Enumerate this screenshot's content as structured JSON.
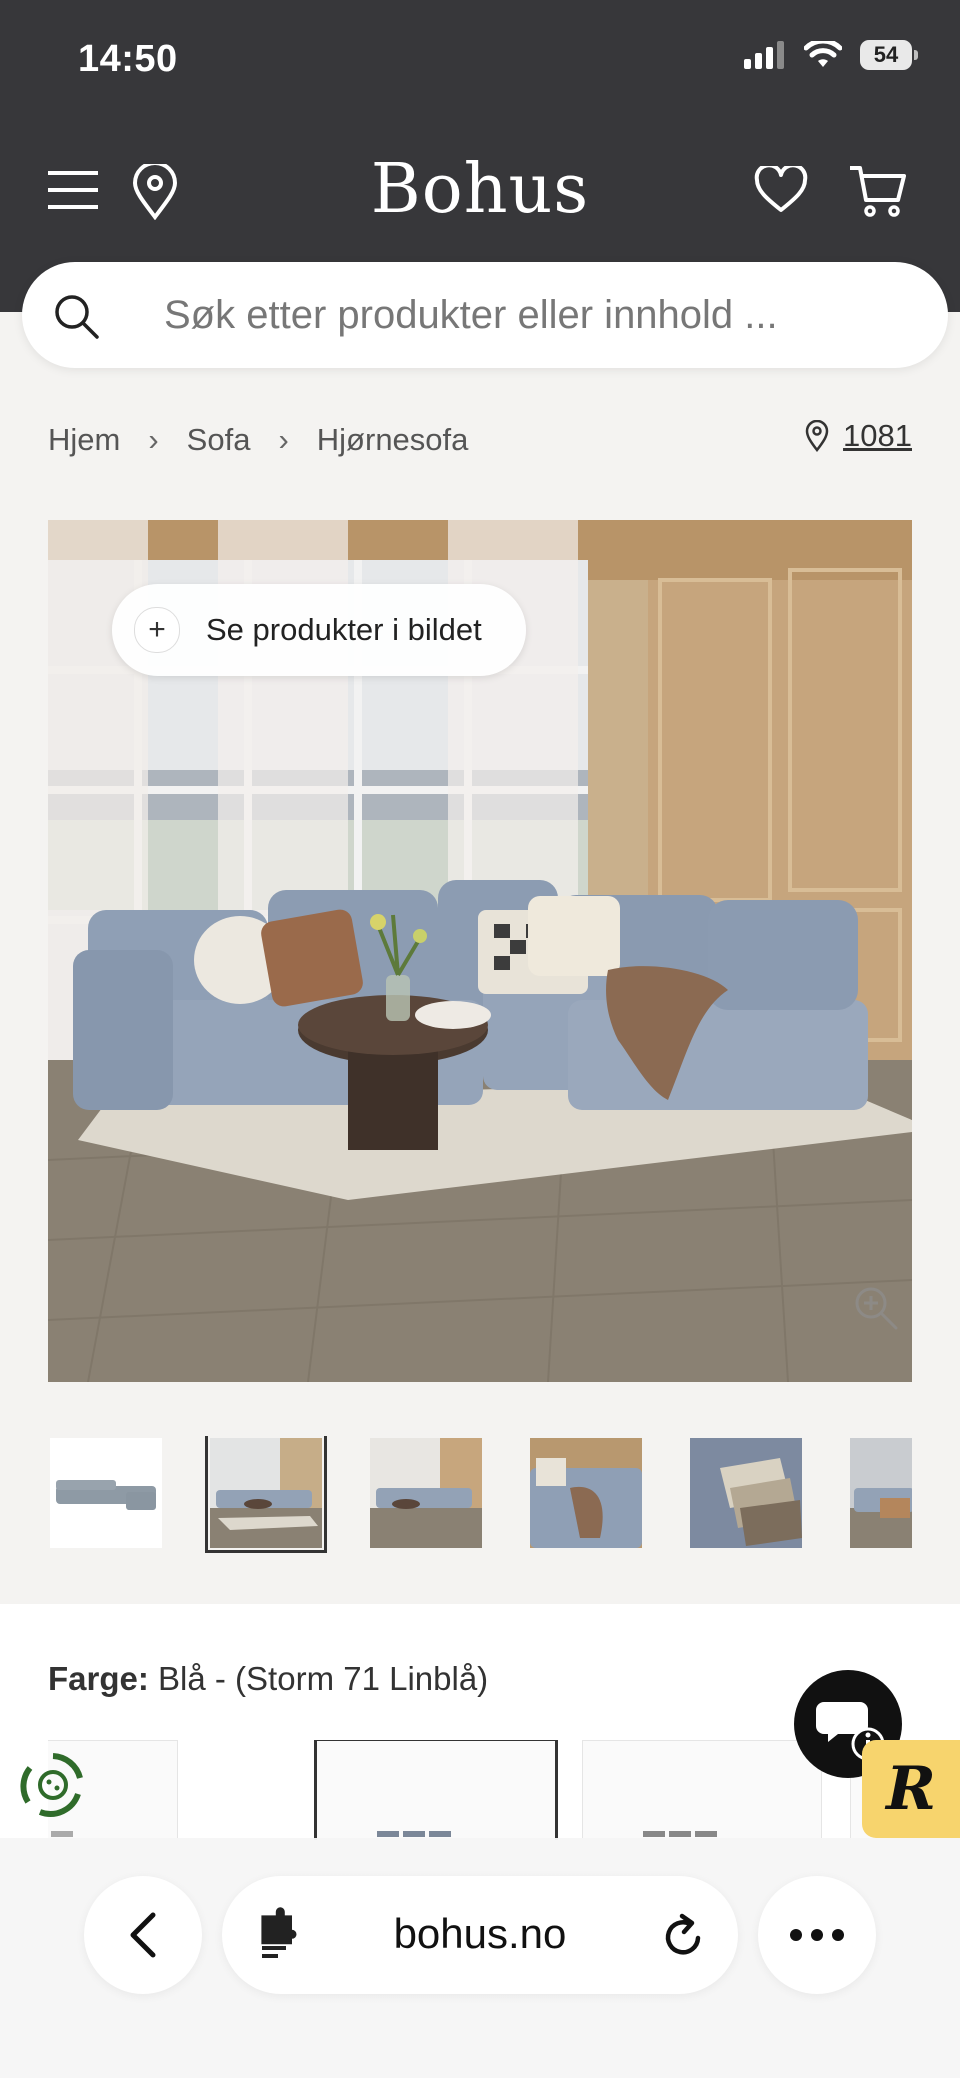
{
  "status_bar": {
    "time": "14:50",
    "battery": "54"
  },
  "header": {
    "brand": "Bohus",
    "icons": [
      "menu-icon",
      "location-pin-icon",
      "heart-icon",
      "cart-icon"
    ]
  },
  "search": {
    "placeholder": "Søk etter produkter eller innhold ..."
  },
  "breadcrumb": {
    "items": [
      "Hjem",
      "Sofa",
      "Hjørnesofa"
    ],
    "store_code": "1081"
  },
  "hero": {
    "see_products_label": "Se produkter i bildet"
  },
  "thumbnails": {
    "count": 6,
    "selected_index": 1
  },
  "color": {
    "label": "Farge:",
    "value": "Blå - (Storm 71 Linblå)"
  },
  "browser": {
    "url": "bohus.no"
  },
  "colors": {
    "header_bg": "#37373a",
    "page_bg": "#f4f3f1",
    "sofa_blue": "#8e9db3",
    "badge_yellow": "#f7d46d"
  }
}
